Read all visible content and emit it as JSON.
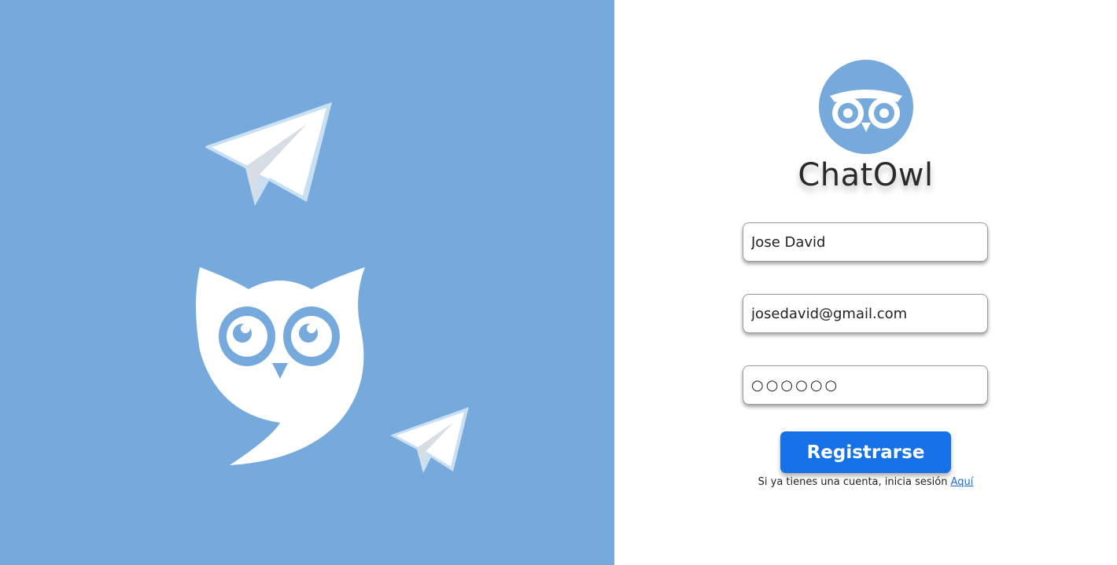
{
  "brand": {
    "app_name": "ChatOwl",
    "logo_icon": "owl-eyes-icon"
  },
  "illustrations": {
    "large_owl": "owl-speech-bubble-icon",
    "planes": [
      "paper-plane-icon",
      "paper-plane-icon"
    ]
  },
  "form": {
    "name_value": "Jose David",
    "email_value": "josedavid@gmail.com",
    "password_value": "○○○○○○",
    "submit_label": "Registrarse"
  },
  "footer": {
    "hint_text": "Si ya tienes una cuenta, inicia sesión ",
    "link_label": "Aquí"
  },
  "colors": {
    "left_background": "#77aadc",
    "accent_button": "#1671e6",
    "link": "#1a6fd6"
  }
}
